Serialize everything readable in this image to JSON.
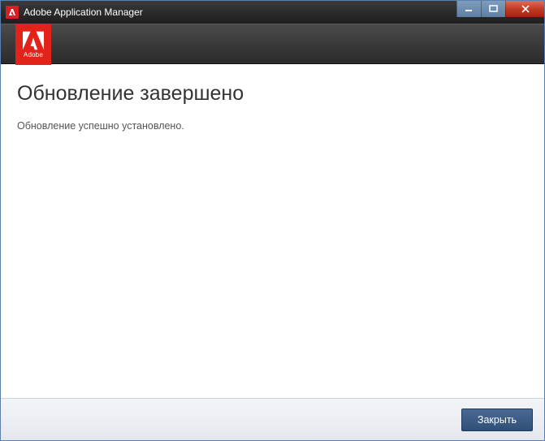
{
  "titlebar": {
    "title": "Adobe Application Manager"
  },
  "header": {
    "badge_text": "Adobe"
  },
  "content": {
    "heading": "Обновление завершено",
    "message": "Обновление успешно установлено."
  },
  "footer": {
    "close_label": "Закрыть"
  }
}
